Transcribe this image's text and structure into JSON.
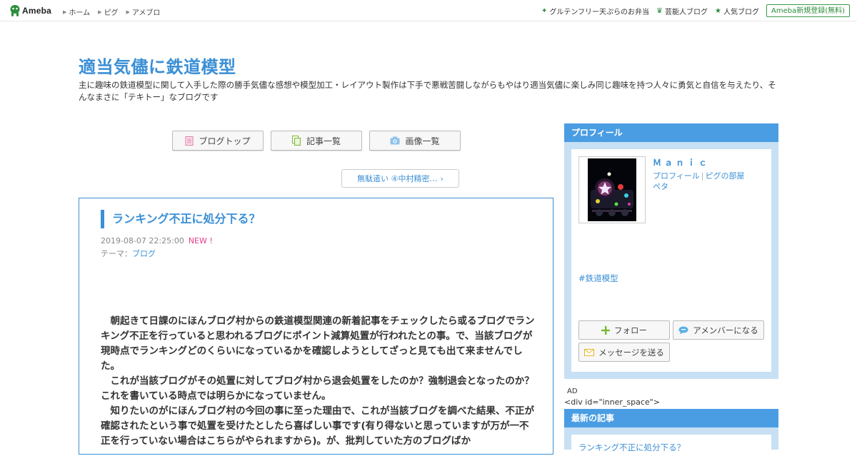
{
  "topbar": {
    "brand": "Ameba",
    "nav": [
      "ホーム",
      "ピグ",
      "アメブロ"
    ],
    "right_links": [
      {
        "icon": "sparkle-icon",
        "label": "グルテンフリー天ぷらのお弁当"
      },
      {
        "icon": "crown-icon",
        "label": "芸能人ブログ"
      },
      {
        "icon": "star-icon",
        "label": "人気ブログ"
      }
    ],
    "register": "Ameba新規登録(無料)"
  },
  "blog": {
    "title": "適当気儘に鉄道模型",
    "description": "主に趣味の鉄道模型に関して入手した際の勝手気儘な感想や模型加工・レイアウト製作は下手で悪戦苦闘しながらもやはり適当気儘に楽しみ同じ趣味を持つ人々に勇気と自信を与えたり、そんなまさに「テキトー」なブログです"
  },
  "tabs": [
    {
      "icon": "document-icon",
      "label": "ブログトップ"
    },
    {
      "icon": "pages-icon",
      "label": "記事一覧"
    },
    {
      "icon": "camera-icon",
      "label": "画像一覧"
    }
  ],
  "prev_article": "無駄遣い ④中村精密…",
  "article": {
    "title": "ランキング不正に処分下る？",
    "date": "2019-08-07 22:25:00",
    "new_badge": "NEW !",
    "theme_label": "テーマ：",
    "theme": "ブログ",
    "paragraphs": [
      "朝起きて日課のにほんブログ村からの鉄道模型関連の新着記事をチェックしたら或るブログでランキング不正を行っていると思われるブログにポイント減算処置が行われたとの事。で、当該ブログが現時点でランキングどのくらいになっているかを確認しようとしてざっと見ても出て来ませんでした。",
      "これが当該ブログがその処置に対してブログ村から退会処置をしたのか？強制退会となったのか？これを書いている時点では明らかになっていません。",
      "知りたいのがにほんブログ村の今回の事に至った理由で、これが当該ブログを調べた結果、不正が確認されたという事で処置を受けたとしたら喜ばしい事です(有り得ないと思っていますが万が一不正を行っていない場合はこちらがやられますから)。が、批判していた方のブログばか"
    ]
  },
  "sidebar": {
    "profile_heading": "プロフィール",
    "name": "Ｍａｎｉｃ",
    "link_profile": "プロフィール",
    "link_separator": "|",
    "link_pig": "ピグの部屋",
    "link_peta": "ペタ",
    "tag": "#鉄道模型",
    "follow": "フォロー",
    "member": "アメンバーになる",
    "message": "メッセージを送る",
    "ad_label": "AD",
    "raw_code": "<div id=\"inner_space\">",
    "latest_heading": "最新の記事",
    "latest_item": "ランキング不正に処分下る？"
  }
}
